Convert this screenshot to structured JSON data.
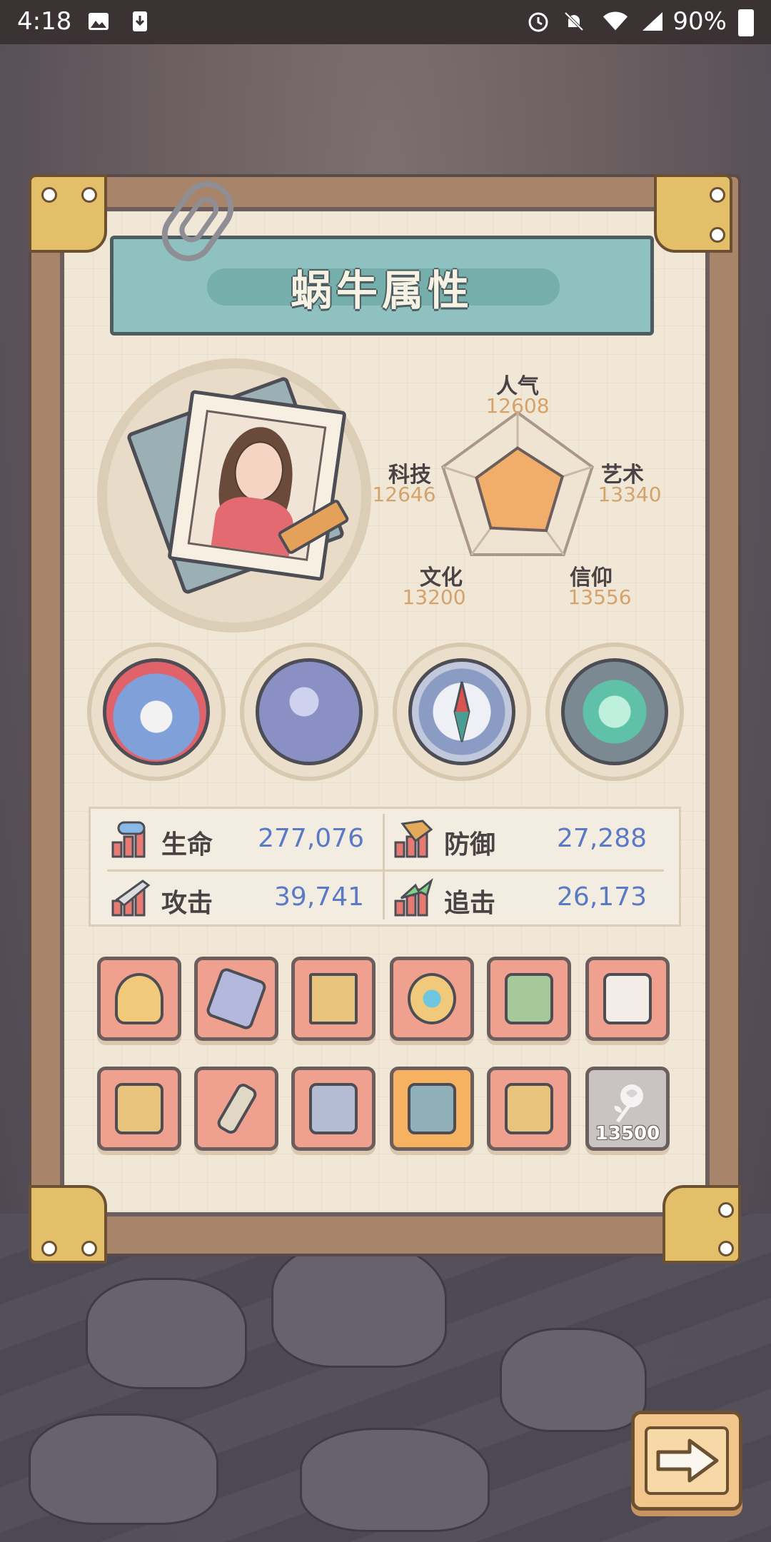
{
  "status_bar": {
    "time": "4:18",
    "battery_percent": "90%",
    "icons": [
      "image-icon",
      "download-icon",
      "alarm-icon",
      "bell-off-icon",
      "wifi-icon",
      "signal-icon",
      "battery-icon"
    ]
  },
  "panel": {
    "title": "蜗牛属性"
  },
  "radar": {
    "stats": [
      {
        "label": "人气",
        "value": "12608"
      },
      {
        "label": "艺术",
        "value": "13340"
      },
      {
        "label": "信仰",
        "value": "13556"
      },
      {
        "label": "文化",
        "value": "13200"
      },
      {
        "label": "科技",
        "value": "12646"
      }
    ],
    "fill_levels": [
      0.55,
      0.6,
      0.62,
      0.58,
      0.55
    ]
  },
  "equipment": {
    "slots": [
      {
        "icon": "shark-octopus-icon",
        "color": "#7fa0d8"
      },
      {
        "icon": "shell-helmet-icon",
        "color": "#8a8fc4"
      },
      {
        "icon": "compass-icon",
        "color": "#8a9cc4"
      },
      {
        "icon": "swirl-orb-icon",
        "color": "#5fc2a8"
      }
    ]
  },
  "stats": {
    "hp": {
      "label": "生命",
      "value": "277,076"
    },
    "defense": {
      "label": "防御",
      "value": "27,288"
    },
    "attack": {
      "label": "攻击",
      "value": "39,741"
    },
    "pursuit": {
      "label": "追击",
      "value": "26,173"
    }
  },
  "items": {
    "row1": [
      {
        "icon": "skull-mace-icon"
      },
      {
        "icon": "crystal-icon"
      },
      {
        "icon": "scales-icon"
      },
      {
        "icon": "crown-icon"
      },
      {
        "icon": "lantern-hammer-icon"
      },
      {
        "icon": "apron-icon"
      }
    ],
    "row2": [
      {
        "icon": "blaster-icon"
      },
      {
        "icon": "dagger-icon"
      },
      {
        "icon": "mech-wings-icon"
      },
      {
        "icon": "gauntlet-icon"
      },
      {
        "icon": "raygun-icon"
      },
      {
        "icon": "rose-icon",
        "locked": true,
        "value": "13500"
      }
    ]
  },
  "colors": {
    "accent_blue": "#5a7ac6",
    "radar_value": "#d4a26a",
    "banner": "#8ec1bf",
    "item_slot": "#f0a08e",
    "item_slot_highlight": "#f6b261"
  }
}
